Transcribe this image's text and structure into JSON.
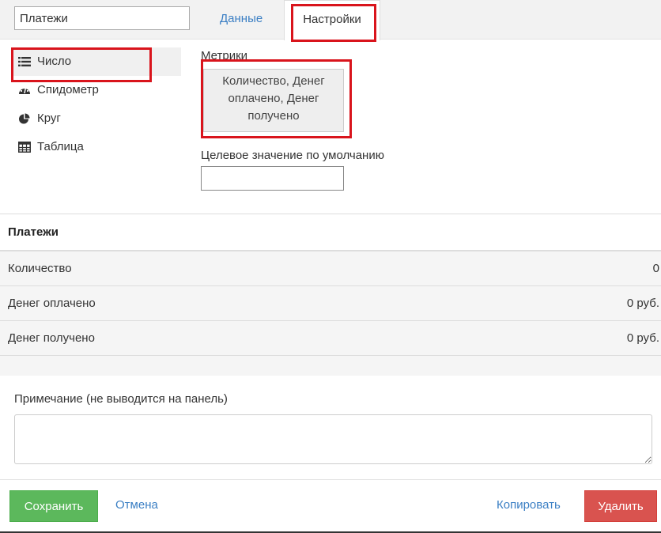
{
  "header": {
    "name_value": "Платежи",
    "tabs": [
      {
        "label": "Данные",
        "active": false
      },
      {
        "label": "Настройки",
        "active": true
      }
    ]
  },
  "chart_types": [
    {
      "label": "Число",
      "icon": "list-icon",
      "active": true
    },
    {
      "label": "Спидометр",
      "icon": "speedometer-icon",
      "active": false
    },
    {
      "label": "Круг",
      "icon": "pie-chart-icon",
      "active": false
    },
    {
      "label": "Таблица",
      "icon": "table-icon",
      "active": false
    }
  ],
  "settings": {
    "metrics_label": "Метрики",
    "metrics_value": "Количество, Денег оплачено, Денег получено",
    "target_label": "Целевое значение по умолчанию",
    "target_value": ""
  },
  "preview": {
    "title": "Платежи",
    "rows": [
      {
        "label": "Количество",
        "value": "0"
      },
      {
        "label": "Денег оплачено",
        "value": "0 руб."
      },
      {
        "label": "Денег получено",
        "value": "0 руб."
      }
    ]
  },
  "note": {
    "label": "Примечание (не выводится на панель)",
    "value": ""
  },
  "footer": {
    "save_label": "Сохранить",
    "cancel_label": "Отмена",
    "copy_label": "Копировать",
    "delete_label": "Удалить"
  },
  "colors": {
    "highlight": "#d9141c",
    "link": "#3b7fc4",
    "save": "#5cb85c",
    "delete": "#d9534f"
  }
}
